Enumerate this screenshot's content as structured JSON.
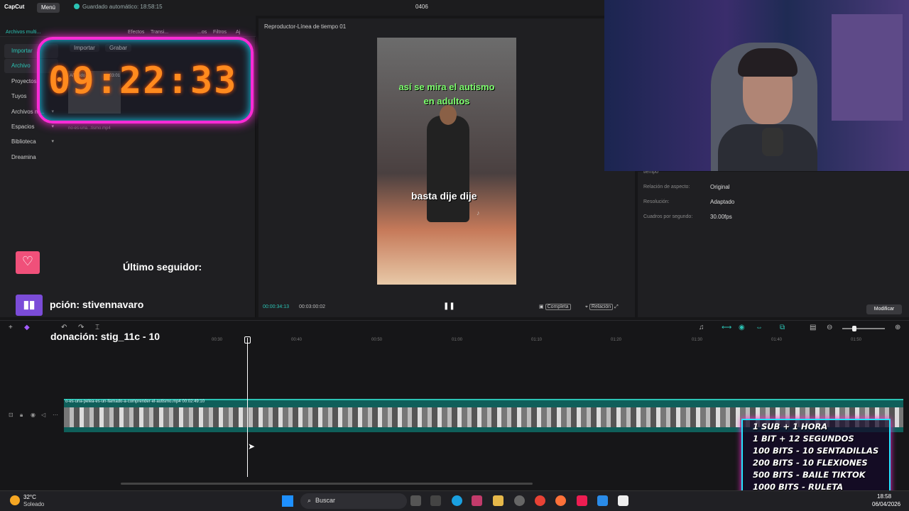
{
  "titlebar": {
    "app_name": "CapCut",
    "menu_label": "Menú",
    "autosave": "Guardado automático: 18:58:15",
    "project_name": "0406"
  },
  "left_panel": {
    "top_tabs": [
      "Archivos multi...",
      "Efectos",
      "Transi...",
      "...os",
      "Filtros",
      "Aj"
    ],
    "nav": [
      {
        "label": "Importar",
        "chevron": ""
      },
      {
        "label": "Archivo",
        "chevron": ""
      },
      {
        "label": "Proyectos",
        "chevron": ""
      },
      {
        "label": "Tuyos",
        "chevron": ""
      },
      {
        "label": "Archivos m...",
        "chevron": "▾"
      },
      {
        "label": "Espacios",
        "chevron": "▾"
      },
      {
        "label": "Biblioteca",
        "chevron": "▾"
      },
      {
        "label": "Dreamina",
        "chevron": ""
      }
    ],
    "import_label": "Importar",
    "record_label": "Grabar",
    "thumb_added": "Añadido",
    "thumb_duration": "03:01",
    "thumb_name": "no-es-una...tismo.mp4"
  },
  "overlay": {
    "timer": "09:22:33",
    "last_follower_label": "Último seguidor:",
    "subscription": "pción: stivennavaro",
    "donation": "donación: stig_11c - 10",
    "bits_lines": [
      "1 SUB + 1 HORA",
      "1 BIT + 12 SEGUNDOS",
      "100 BITS - 10 SENTADILLAS",
      "200 BITS - 10 FLEXIONES",
      "500 BITS - BAILE TIKTOK",
      "1000 BITS - RULETA"
    ]
  },
  "player": {
    "title": "Reproductor-Línea de tiempo 01",
    "caption_line1": "así se mira el autismo",
    "caption_line2": "en adultos",
    "caption_line3": "basta dije dije",
    "time_current": "00:00:34:13",
    "time_total": "00:03:00:02",
    "full_label": "Completa",
    "ratio_label": "Relación"
  },
  "properties": {
    "rows": [
      {
        "label": "Relación de aspecto:",
        "value": "Original"
      },
      {
        "label": "Resolución:",
        "value": "Adaptado"
      },
      {
        "label": "Cuadros por segundo:",
        "value": "30.00fps"
      }
    ],
    "header_hint": "tiempo",
    "modify_label": "Modificar"
  },
  "timeline": {
    "ruler_ticks": [
      "00:30",
      "00:40",
      "00:50",
      "01:00",
      "01:10",
      "01:20",
      "01:30",
      "01:40",
      "01:50"
    ],
    "clip_label": "o-es-una-pelea-es-un-llamado-a-comprender-el-autismo.mp4   00:02:49:10",
    "progress_fraction": 0.19
  },
  "taskbar": {
    "weather_temp": "32°C",
    "weather_desc": "Soleado",
    "search_label": "Buscar",
    "clock_time": "18:58",
    "clock_date": "06/04/2026"
  },
  "colors": {
    "accent": "#2bc3b4",
    "timer_digits": "#ff8a1e",
    "neon_border": "#ff2bd6"
  }
}
